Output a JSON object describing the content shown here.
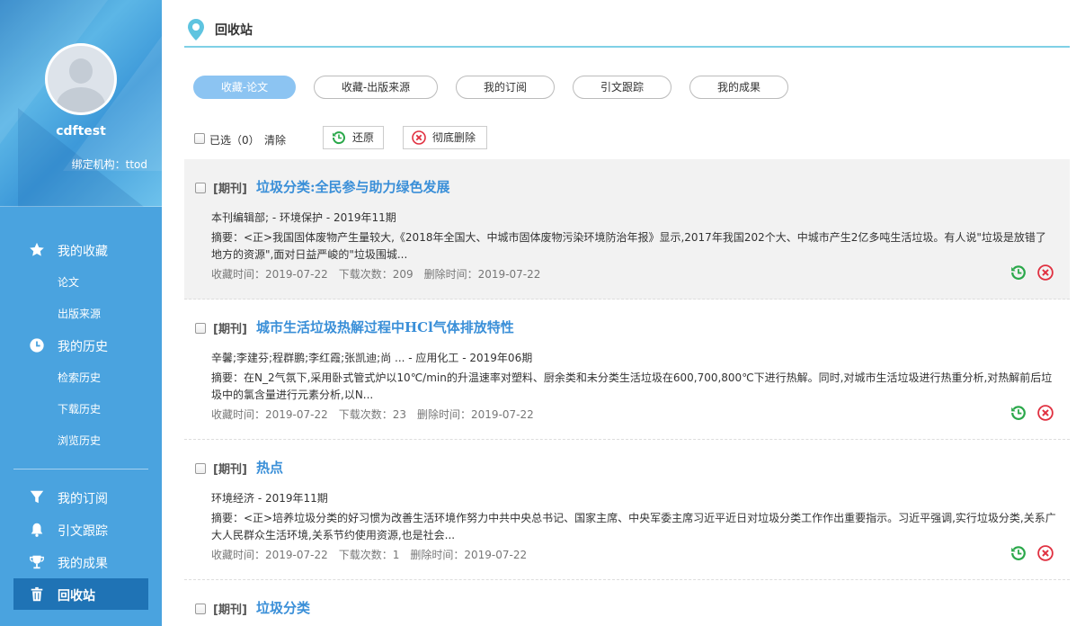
{
  "sidebar": {
    "username": "cdftest",
    "org_label": "绑定机构：ttod",
    "favorites": {
      "label": "我的收藏",
      "items": [
        "论文",
        "出版来源"
      ]
    },
    "history": {
      "label": "我的历史",
      "items": [
        "检索历史",
        "下载历史",
        "浏览历史"
      ]
    },
    "subscriptions": "我的订阅",
    "citation_tracking": "引文跟踪",
    "achievements": "我的成果",
    "recycle": "回收站"
  },
  "header": {
    "title": "回收站"
  },
  "tabs": [
    "收藏-论文",
    "收藏-出版来源",
    "我的订阅",
    "引文跟踪",
    "我的成果"
  ],
  "toolbar": {
    "selected": "已选（0）",
    "clear": "清除",
    "restore": "还原",
    "delete_forever": "彻底删除"
  },
  "items": [
    {
      "type": "[期刊]",
      "title": "垃圾分类:全民参与助力绿色发展",
      "meta": "本刊编辑部;   -   环境保护   -   2019年11期",
      "abstract": "摘要：<正>我国固体废物产生量较大,《2018年全国大、中城市固体废物污染环境防治年报》显示,2017年我国202个大、中城市产生2亿多吨生活垃圾。有人说\"垃圾是放错了地方的资源\",面对日益严峻的\"垃圾围城...",
      "fav_time": "收藏时间：2019-07-22",
      "downloads": "下载次数：209",
      "del_time": "删除时间：2019-07-22"
    },
    {
      "type": "[期刊]",
      "title": "城市生活垃圾热解过程中HCl气体排放特性",
      "meta": "辛馨;李建芬;程群鹏;李红霞;张凯迪;尚 ...   -   应用化工   -   2019年06期",
      "abstract": "摘要：在N_2气氛下,采用卧式管式炉以10℃/min的升温速率对塑料、厨余类和未分类生活垃圾在600,700,800℃下进行热解。同时,对城市生活垃圾进行热重分析,对热解前后垃圾中的氯含量进行元素分析,以N...",
      "fav_time": "收藏时间：2019-07-22",
      "downloads": "下载次数：23",
      "del_time": "删除时间：2019-07-22"
    },
    {
      "type": "[期刊]",
      "title": "热点",
      "meta": "环境经济   -   2019年11期",
      "abstract": "摘要：<正>培养垃圾分类的好习惯为改善生活环境作努力中共中央总书记、国家主席、中央军委主席习近平近日对垃圾分类工作作出重要指示。习近平强调,实行垃圾分类,关系广大人民群众生活环境,关系节约使用资源,也是社会...",
      "fav_time": "收藏时间：2019-07-22",
      "downloads": "下载次数：1",
      "del_time": "删除时间：2019-07-22"
    },
    {
      "type": "[期刊]",
      "title": "垃圾分类"
    }
  ],
  "colors": {
    "sidebar": "#4aa3df",
    "active_nav": "#1f73b5",
    "active_tab": "#8cc4f2",
    "title_link": "#3a8fd8",
    "restore_icon": "#2aa84a",
    "delete_icon": "#e03040"
  }
}
